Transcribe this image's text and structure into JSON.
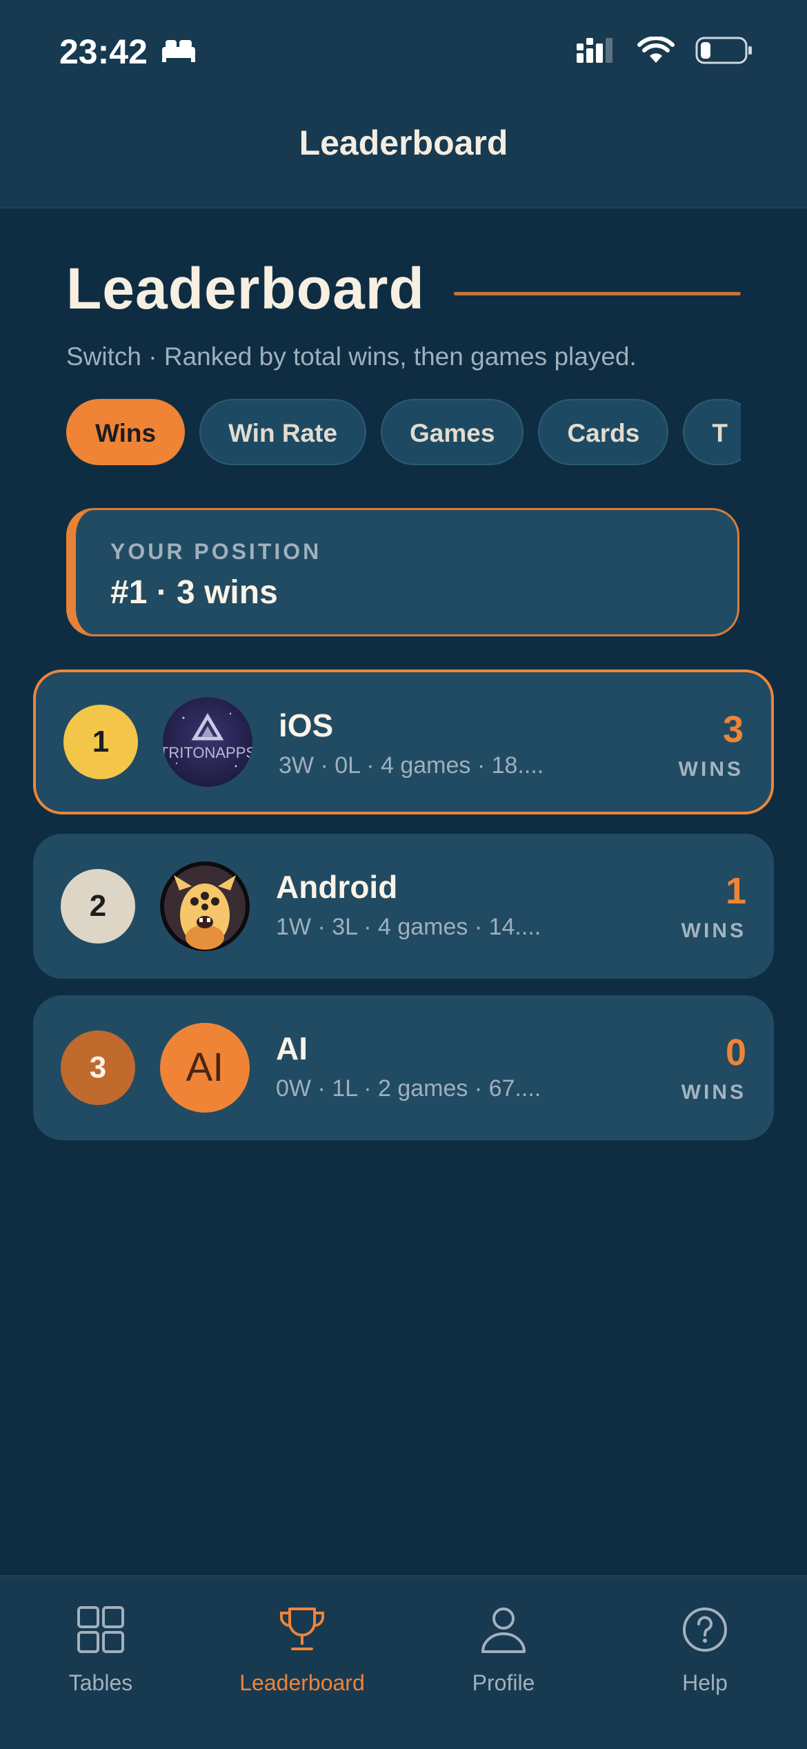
{
  "status_bar": {
    "time": "23:42"
  },
  "nav": {
    "title": "Leaderboard"
  },
  "page": {
    "title": "Leaderboard",
    "subtitle": "Switch · Ranked by total wins, then games played."
  },
  "filters": [
    {
      "label": "Wins",
      "active": true
    },
    {
      "label": "Win Rate",
      "active": false
    },
    {
      "label": "Games",
      "active": false
    },
    {
      "label": "Cards",
      "active": false
    },
    {
      "label": "T",
      "active": false
    }
  ],
  "your_position": {
    "label": "YOUR POSITION",
    "value": "#1 · 3 wins"
  },
  "players": [
    {
      "rank": "1",
      "name": "iOS",
      "stats": "3W · 0L · 4 games · 18....",
      "score": "3",
      "score_label": "WINS",
      "avatar": "tritonapps-logo",
      "avatar_text": "TRITONAPPS"
    },
    {
      "rank": "2",
      "name": "Android",
      "stats": "1W · 3L · 4 games · 14....",
      "score": "1",
      "score_label": "WINS",
      "avatar": "monster-avatar"
    },
    {
      "rank": "3",
      "name": "AI",
      "stats": "0W · 1L · 2 games · 67....",
      "score": "0",
      "score_label": "WINS",
      "avatar": "initials-avatar",
      "avatar_text": "AI"
    }
  ],
  "tabs": [
    {
      "label": "Tables",
      "icon": "grid-icon",
      "active": false
    },
    {
      "label": "Leaderboard",
      "icon": "trophy-icon",
      "active": true
    },
    {
      "label": "Profile",
      "icon": "person-icon",
      "active": false
    },
    {
      "label": "Help",
      "icon": "question-icon",
      "active": false
    }
  ],
  "colors": {
    "background": "#0f2d42",
    "card": "#214b63",
    "accent": "#f08436",
    "gold": "#f3c64a",
    "silver": "#ddd6c6",
    "bronze": "#c06a2e"
  }
}
